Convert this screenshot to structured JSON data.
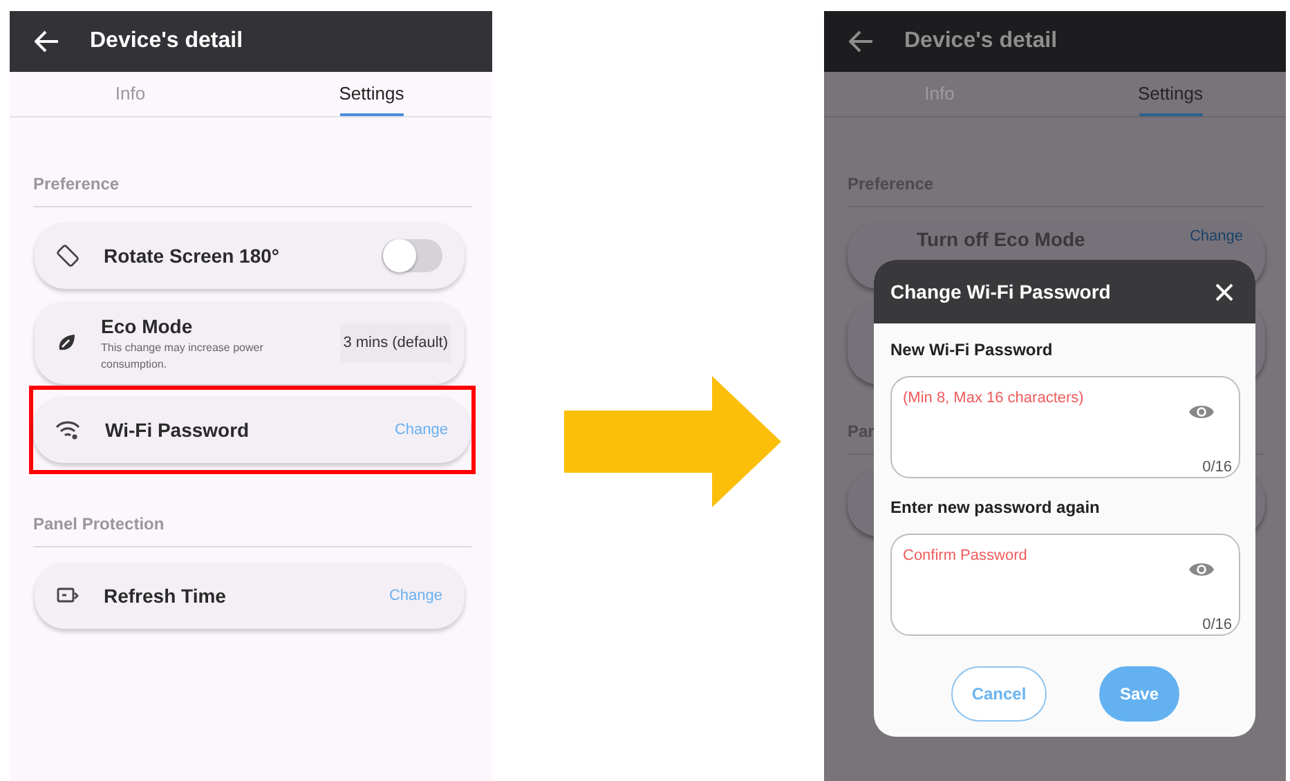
{
  "before_screen": {
    "header": {
      "title": "Device's detail"
    },
    "tabs": [
      {
        "label": "Info",
        "selected": false
      },
      {
        "label": "Settings",
        "selected": true
      }
    ],
    "sections": [
      {
        "title": "Preference",
        "items": [
          {
            "kind": "toggle",
            "label": "Rotate Screen 180°",
            "on": false,
            "highlighted": false
          },
          {
            "kind": "value",
            "label": "Eco Mode",
            "description": "This change may increase power consumption.",
            "value": "3 mins (default)",
            "highlighted": false
          },
          {
            "kind": "link",
            "label": "Wi-Fi Password",
            "action": "Change",
            "highlighted": true
          }
        ]
      },
      {
        "title": "Panel Protection",
        "items": [
          {
            "kind": "link",
            "label": "Refresh Time",
            "action": "Change",
            "highlighted": false
          }
        ]
      }
    ]
  },
  "after_screen": {
    "header": {
      "title": "Device's detail"
    },
    "tabs": [
      {
        "label": "Info",
        "selected": false
      },
      {
        "label": "Settings",
        "selected": true
      }
    ],
    "section_title": "Preference",
    "partial_item": {
      "label": "Turn off Eco Mode",
      "action": "Change"
    },
    "partial_section_title": "Par",
    "dialog": {
      "title": "Change Wi-Fi Password",
      "fields": [
        {
          "label": "New Wi-Fi Password",
          "placeholder": "(Min 8, Max 16 characters)",
          "counter": "0/16"
        },
        {
          "label": "Enter new password again",
          "placeholder": "Confirm Password",
          "counter": "0/16"
        }
      ],
      "buttons": [
        {
          "label": "Cancel",
          "kind": "outlined"
        },
        {
          "label": "Save",
          "kind": "filled"
        }
      ]
    }
  }
}
